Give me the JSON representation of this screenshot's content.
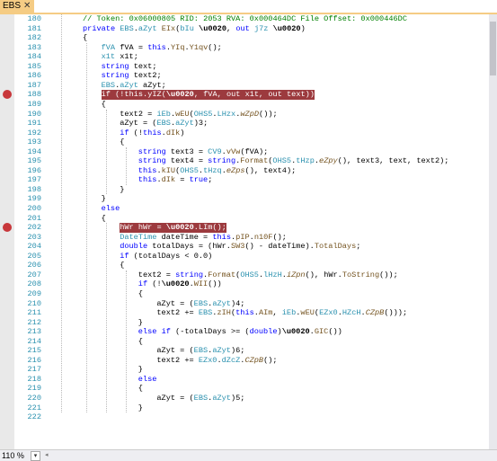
{
  "tab": {
    "label": "EBS",
    "close_glyph": "✕"
  },
  "status": {
    "zoom": "110 %",
    "zoom_dropdown_glyph": "▾",
    "hscroll_left_glyph": "◂"
  },
  "colors": {
    "tab_active": "#f5cc84",
    "breakpoint": "#c8373b",
    "line_number": "#2b91af",
    "keyword": "#0000ff",
    "type": "#2b91af",
    "comment": "#008000"
  },
  "lines": [
    {
      "n": "180",
      "i": 0,
      "t": [
        [
          "cm",
          "// Token: 0x06000805 RID: 2053 RVA: 0x000464DC File Offset: 0x000446DC"
        ]
      ]
    },
    {
      "n": "181",
      "i": 0,
      "t": [
        [
          "kw",
          "private "
        ],
        [
          "ty",
          "EBS"
        ],
        [
          "",
          "."
        ],
        [
          "ty",
          "aZyt "
        ],
        [
          "mt",
          "EIx"
        ],
        [
          "",
          "("
        ],
        [
          "ty",
          "bIu"
        ],
        [
          "",
          " "
        ],
        [
          "b",
          "\\u0020"
        ],
        [
          "",
          ", "
        ],
        [
          "kw",
          "out "
        ],
        [
          "ty",
          "j7z"
        ],
        [
          "",
          " "
        ],
        [
          "b",
          "\\u0020"
        ],
        [
          "",
          ")"
        ]
      ]
    },
    {
      "n": "182",
      "i": 0,
      "t": [
        [
          "",
          "{"
        ]
      ]
    },
    {
      "n": "183",
      "i": 1,
      "t": [
        [
          "ty",
          "fVA "
        ],
        [
          "",
          "fVA = "
        ],
        [
          "kw",
          "this"
        ],
        [
          "",
          "."
        ],
        [
          "mt",
          "YIq"
        ],
        [
          "",
          "."
        ],
        [
          "mt",
          "Y1qv"
        ],
        [
          "",
          "();"
        ]
      ]
    },
    {
      "n": "184",
      "i": 1,
      "t": [
        [
          "ty",
          "x1t "
        ],
        [
          "",
          "x1t;"
        ]
      ]
    },
    {
      "n": "185",
      "i": 1,
      "t": [
        [
          "kw",
          "string "
        ],
        [
          "",
          "text;"
        ]
      ]
    },
    {
      "n": "186",
      "i": 1,
      "t": [
        [
          "kw",
          "string "
        ],
        [
          "",
          "text2;"
        ]
      ]
    },
    {
      "n": "187",
      "i": 1,
      "t": [
        [
          "ty",
          "EBS"
        ],
        [
          "",
          "."
        ],
        [
          "ty",
          "aZyt "
        ],
        [
          "",
          "aZyt;"
        ]
      ]
    },
    {
      "n": "188",
      "i": 1,
      "bp": true,
      "hl": true,
      "t": [
        [
          "kw",
          "if "
        ],
        [
          "",
          "(!"
        ],
        [
          "kw",
          "this"
        ],
        [
          "",
          "."
        ],
        [
          "mt",
          "yIZ"
        ],
        [
          "",
          "("
        ],
        [
          "b",
          "\\u0020"
        ],
        [
          "",
          ", fVA, "
        ],
        [
          "kw",
          "out "
        ],
        [
          "",
          "x1t, "
        ],
        [
          "kw",
          "out "
        ],
        [
          "",
          "text))"
        ]
      ]
    },
    {
      "n": "189",
      "i": 1,
      "t": [
        [
          "",
          "{"
        ]
      ]
    },
    {
      "n": "190",
      "i": 2,
      "t": [
        [
          "",
          "text2 = "
        ],
        [
          "ty",
          "iEb"
        ],
        [
          "",
          "."
        ],
        [
          "mt",
          "wEU"
        ],
        [
          "",
          "("
        ],
        [
          "ty",
          "OHS5"
        ],
        [
          "",
          "."
        ],
        [
          "ty",
          "LHzx"
        ],
        [
          "",
          "."
        ],
        [
          "it",
          "wZpD"
        ],
        [
          "",
          "());"
        ]
      ]
    },
    {
      "n": "191",
      "i": 2,
      "t": [
        [
          "",
          "aZyt = ("
        ],
        [
          "ty",
          "EBS"
        ],
        [
          "",
          "."
        ],
        [
          "ty",
          "aZyt"
        ],
        [
          "",
          ")3;"
        ]
      ]
    },
    {
      "n": "192",
      "i": 2,
      "t": [
        [
          "kw",
          "if "
        ],
        [
          "",
          "(!"
        ],
        [
          "kw",
          "this"
        ],
        [
          "",
          "."
        ],
        [
          "mt",
          "dIk"
        ],
        [
          "",
          ")"
        ]
      ]
    },
    {
      "n": "193",
      "i": 2,
      "t": [
        [
          "",
          "{"
        ]
      ]
    },
    {
      "n": "194",
      "i": 3,
      "t": [
        [
          "kw",
          "string "
        ],
        [
          "",
          "text3 = "
        ],
        [
          "ty",
          "CV9"
        ],
        [
          "",
          "."
        ],
        [
          "mt",
          "vVw"
        ],
        [
          "",
          "(fVA);"
        ]
      ]
    },
    {
      "n": "195",
      "i": 3,
      "t": [
        [
          "kw",
          "string "
        ],
        [
          "",
          "text4 = "
        ],
        [
          "kw",
          "string"
        ],
        [
          "",
          "."
        ],
        [
          "mt",
          "Format"
        ],
        [
          "",
          "("
        ],
        [
          "ty",
          "OHS5"
        ],
        [
          "",
          "."
        ],
        [
          "ty",
          "tHzp"
        ],
        [
          "",
          "."
        ],
        [
          "it",
          "eZpy"
        ],
        [
          "",
          "(), text3, text, text2);"
        ]
      ]
    },
    {
      "n": "196",
      "i": 3,
      "t": [
        [
          "kw",
          "this"
        ],
        [
          "",
          "."
        ],
        [
          "mt",
          "kIU"
        ],
        [
          "",
          "("
        ],
        [
          "ty",
          "OHS5"
        ],
        [
          "",
          "."
        ],
        [
          "ty",
          "tHzq"
        ],
        [
          "",
          "."
        ],
        [
          "it",
          "eZps"
        ],
        [
          "",
          "(), text4);"
        ]
      ]
    },
    {
      "n": "197",
      "i": 3,
      "t": [
        [
          "kw",
          "this"
        ],
        [
          "",
          "."
        ],
        [
          "mt",
          "dIk"
        ],
        [
          "",
          " = "
        ],
        [
          "kw",
          "true"
        ],
        [
          "",
          ";"
        ]
      ]
    },
    {
      "n": "198",
      "i": 2,
      "t": [
        [
          "",
          "}"
        ]
      ]
    },
    {
      "n": "199",
      "i": 1,
      "t": [
        [
          "",
          "}"
        ]
      ]
    },
    {
      "n": "200",
      "i": 1,
      "t": [
        [
          "kw",
          "else"
        ]
      ]
    },
    {
      "n": "201",
      "i": 1,
      "t": [
        [
          "",
          "{"
        ]
      ]
    },
    {
      "n": "202",
      "i": 2,
      "bp": true,
      "hl": true,
      "t": [
        [
          "ty",
          "hWr "
        ],
        [
          "",
          "hWr = "
        ],
        [
          "b",
          "\\u0020"
        ],
        [
          "",
          "."
        ],
        [
          "mt",
          "LIm"
        ],
        [
          "",
          "();"
        ]
      ]
    },
    {
      "n": "203",
      "i": 2,
      "t": [
        [
          "ty",
          "DateTime "
        ],
        [
          "",
          "dateTime = "
        ],
        [
          "kw",
          "this"
        ],
        [
          "",
          "."
        ],
        [
          "mt",
          "pIP"
        ],
        [
          "",
          "."
        ],
        [
          "mt",
          "n10F"
        ],
        [
          "",
          "();"
        ]
      ]
    },
    {
      "n": "204",
      "i": 2,
      "t": [
        [
          "kw",
          "double "
        ],
        [
          "",
          "totalDays = (hWr."
        ],
        [
          "mt",
          "SW3"
        ],
        [
          "",
          "() - dateTime)."
        ],
        [
          "mt",
          "TotalDays"
        ],
        [
          "",
          ";"
        ]
      ]
    },
    {
      "n": "205",
      "i": 2,
      "t": [
        [
          "kw",
          "if "
        ],
        [
          "",
          "(totalDays < 0.0)"
        ]
      ]
    },
    {
      "n": "206",
      "i": 2,
      "t": [
        [
          "",
          "{"
        ]
      ]
    },
    {
      "n": "207",
      "i": 3,
      "t": [
        [
          "",
          "text2 = "
        ],
        [
          "kw",
          "string"
        ],
        [
          "",
          "."
        ],
        [
          "mt",
          "Format"
        ],
        [
          "",
          "("
        ],
        [
          "ty",
          "OHS5"
        ],
        [
          "",
          "."
        ],
        [
          "ty",
          "lHzH"
        ],
        [
          "",
          "."
        ],
        [
          "it",
          "iZpn"
        ],
        [
          "",
          "(), hWr."
        ],
        [
          "mt",
          "ToString"
        ],
        [
          "",
          "());"
        ]
      ]
    },
    {
      "n": "208",
      "i": 3,
      "t": [
        [
          "kw",
          "if "
        ],
        [
          "",
          "(!"
        ],
        [
          "b",
          "\\u0020"
        ],
        [
          "",
          "."
        ],
        [
          "mt",
          "WII"
        ],
        [
          "",
          "())"
        ]
      ]
    },
    {
      "n": "209",
      "i": 3,
      "t": [
        [
          "",
          "{"
        ]
      ]
    },
    {
      "n": "210",
      "i": 4,
      "t": [
        [
          "",
          "aZyt = ("
        ],
        [
          "ty",
          "EBS"
        ],
        [
          "",
          "."
        ],
        [
          "ty",
          "aZyt"
        ],
        [
          "",
          ")4;"
        ]
      ]
    },
    {
      "n": "211",
      "i": 4,
      "t": [
        [
          "",
          "text2 += "
        ],
        [
          "ty",
          "EBS"
        ],
        [
          "",
          "."
        ],
        [
          "mt",
          "zIH"
        ],
        [
          "",
          "("
        ],
        [
          "kw",
          "this"
        ],
        [
          "",
          "."
        ],
        [
          "mt",
          "AIm"
        ],
        [
          "",
          ", "
        ],
        [
          "ty",
          "iEb"
        ],
        [
          "",
          "."
        ],
        [
          "mt",
          "wEU"
        ],
        [
          "",
          "("
        ],
        [
          "ty",
          "EZx0"
        ],
        [
          "",
          "."
        ],
        [
          "ty",
          "HZcH"
        ],
        [
          "",
          "."
        ],
        [
          "it",
          "CZpB"
        ],
        [
          "",
          "()));"
        ]
      ]
    },
    {
      "n": "212",
      "i": 3,
      "t": [
        [
          "",
          "}"
        ]
      ]
    },
    {
      "n": "213",
      "i": 3,
      "t": [
        [
          "kw",
          "else if "
        ],
        [
          "",
          "(-totalDays >= ("
        ],
        [
          "kw",
          "double"
        ],
        [
          "",
          ")"
        ],
        [
          "b",
          "\\u0020"
        ],
        [
          "",
          "."
        ],
        [
          "mt",
          "GIC"
        ],
        [
          "",
          "())"
        ]
      ]
    },
    {
      "n": "214",
      "i": 3,
      "t": [
        [
          "",
          "{"
        ]
      ]
    },
    {
      "n": "215",
      "i": 4,
      "t": [
        [
          "",
          "aZyt = ("
        ],
        [
          "ty",
          "EBS"
        ],
        [
          "",
          "."
        ],
        [
          "ty",
          "aZyt"
        ],
        [
          "",
          ")6;"
        ]
      ]
    },
    {
      "n": "216",
      "i": 4,
      "t": [
        [
          "",
          "text2 += "
        ],
        [
          "ty",
          "EZx0"
        ],
        [
          "",
          "."
        ],
        [
          "ty",
          "dZcZ"
        ],
        [
          "",
          "."
        ],
        [
          "it",
          "CZpB"
        ],
        [
          "",
          "();"
        ]
      ]
    },
    {
      "n": "217",
      "i": 3,
      "t": [
        [
          "",
          "}"
        ]
      ]
    },
    {
      "n": "218",
      "i": 3,
      "t": [
        [
          "kw",
          "else"
        ]
      ]
    },
    {
      "n": "219",
      "i": 3,
      "t": [
        [
          "",
          "{"
        ]
      ]
    },
    {
      "n": "220",
      "i": 4,
      "t": [
        [
          "",
          "aZyt = ("
        ],
        [
          "ty",
          "EBS"
        ],
        [
          "",
          "."
        ],
        [
          "ty",
          "aZyt"
        ],
        [
          "",
          ")5;"
        ]
      ]
    },
    {
      "n": "221",
      "i": 3,
      "t": [
        [
          "",
          "}"
        ]
      ]
    },
    {
      "n": "222",
      "i": 2,
      "t": [
        [
          "",
          ""
        ]
      ]
    }
  ]
}
